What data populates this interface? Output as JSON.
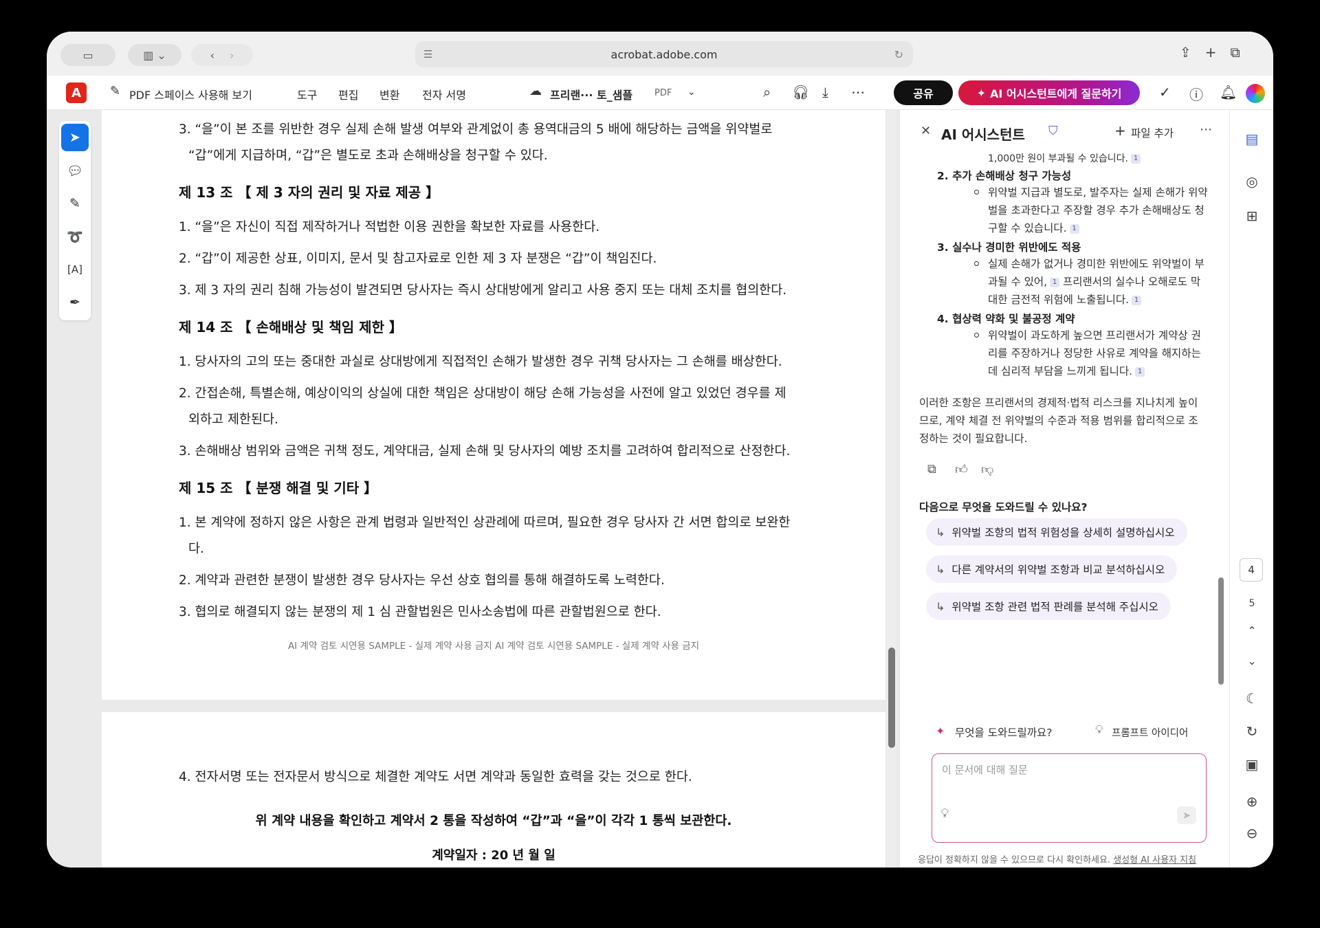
{
  "browser": {
    "url": "acrobat.adobe.com"
  },
  "toolbar": {
    "pdf_space": "PDF 스페이스 사용해 보기",
    "menu": [
      "도구",
      "편집",
      "변환",
      "전자 서명"
    ],
    "doc_name": "프리랜··· 토_샘플",
    "doc_type": "PDF",
    "share": "공유",
    "ai_ask": "AI 어시스턴트에게 질문하기"
  },
  "document": {
    "top_lines": [
      "3. “을”이 본 조를 위반한 경우 실제 손해 발생 여부와 관계없이 총 용역대금의 5 배에 해당하는 금액을 위약벌로",
      "“갑”에게 지급하며, “갑”은 별도로 초과 손해배상을 청구할 수 있다."
    ],
    "art13_title": "제 13 조 【 제 3 자의 권리 및 자료 제공 】",
    "art13": [
      "1. “을”은 자신이 직접 제작하거나 적법한 이용 권한을 확보한 자료를 사용한다.",
      "2. “갑”이 제공한 상표, 이미지, 문서 및 참고자료로 인한 제 3 자 분쟁은 “갑”이 책임진다.",
      "3. 제 3 자의 권리 침해 가능성이 발견되면 당사자는 즉시 상대방에게 알리고 사용 중지 또는 대체 조치를 협의한다."
    ],
    "art14_title": "제 14 조 【 손해배상 및 책임 제한 】",
    "art14": [
      "1. 당사자의 고의 또는 중대한 과실로 상대방에게 직접적인 손해가 발생한 경우 귀책 당사자는 그 손해를 배상한다.",
      "2. 간접손해, 특별손해, 예상이익의 상실에 대한 책임은 상대방이 해당 손해 가능성을 사전에 알고 있었던 경우를 제",
      "외하고 제한된다.",
      "3. 손해배상 범위와 금액은 귀책 정도, 계약대금, 실제 손해 및 당사자의 예방 조치를 고려하여 합리적으로 산정한다."
    ],
    "art15_title": "제 15 조 【 분쟁 해결 및 기타 】",
    "art15": [
      "1. 본 계약에 정하지 않은 사항은 관계 법령과 일반적인 상관례에 따르며, 필요한 경우 당사자 간 서면 합의로 보완한",
      "다.",
      "2. 계약과 관련한 분쟁이 발생한 경우 당사자는 우선 상호 협의를 통해 해결하도록 노력한다.",
      "3. 협의로 해결되지 않는 분쟁의 제 1 심 관할법원은 민사소송법에 따른 관할법원으로 한다."
    ],
    "footer": "AI 계약 검토 시연용 SAMPLE - 실제 계약 사용 금지 AI 계약 검토 시연용 SAMPLE - 실제 계약 사용 금지",
    "page2_line": "4. 전자서명 또는 전자문서 방식으로 체결한 계약도 서면 계약과 동일한 효력을 갖는 것으로 한다.",
    "page2_center": "위 계약 내용을 확인하고 계약서 2 통을 작성하여 “갑”과 “을”이 각각 1 통씩 보관한다.",
    "page2_cut": "계약일자 : 20    년     월     일"
  },
  "ai": {
    "title": "AI 어시스턴트",
    "add_file": "파일 추가",
    "top_partial": "1,000만 원이 부과될 수 있습니다.",
    "items": [
      {
        "num": "2.",
        "title": "추가 손해배상 청구 가능성",
        "lines": [
          "위약벌 지급과 별도로, 발주자는 실제 손해가 위약",
          "벌을 초과한다고 주장할 경우 추가 손해배상도 청",
          "구할 수 있습니다."
        ]
      },
      {
        "num": "3.",
        "title": "실수나 경미한 위반에도 적용",
        "lines": [
          "실제 손해가 없거나 경미한 위반에도 위약벌이 부",
          "과될 수 있어,",
          "프리랜서의 실수나 오해로도 막",
          "대한 금전적 위험에 노출됩니다."
        ]
      },
      {
        "num": "4.",
        "title": "협상력 약화 및 불공정 계약",
        "lines": [
          "위약벌이 과도하게 높으면 프리랜서가 계약상 권",
          "리를 주장하거나 정당한 사유로 계약을 해지하는",
          "데 심리적 부담을 느끼게 됩니다."
        ]
      }
    ],
    "cite": "1",
    "summary": [
      "이러한 조항은 프리랜서의 경제적·법적 리스크를 지나치게 높이",
      "므로, 계약 체결 전 위약벌의 수준과 적용 범위를 합리적으로 조",
      "정하는 것이 필요합니다."
    ],
    "next_heading": "다음으로 무엇을 도와드릴 수 있나요?",
    "suggestions": [
      "위약벌 조항의 법적 위험성을 상세히 설명하십시오",
      "다른 계약서의 위약벌 조항과 비교 분석하십시오",
      "위약벌 조항 관련 법적 판례를 분석해 주십시오"
    ],
    "help_label": "무엇을 도와드릴까요?",
    "prompt_ideas": "프롬프트 아이디어",
    "input_placeholder": "이 문서에 대해 질문",
    "disclaimer": "응답이 정확하지 않을 수 있으므로 다시 확인하세요.",
    "disclaimer_link": "생성형 AI 사용자 지침"
  },
  "rail": {
    "page_current": "4",
    "page_next": "5"
  }
}
